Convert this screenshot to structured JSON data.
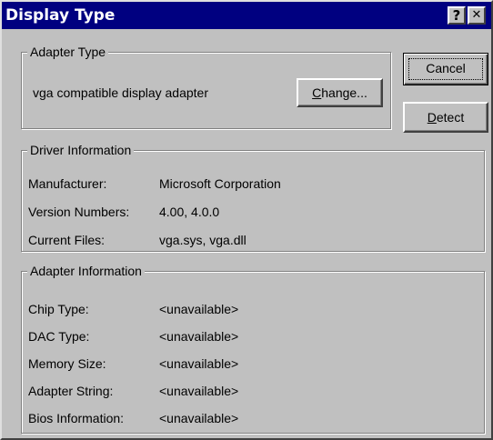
{
  "window": {
    "title": "Display Type",
    "help_glyph": "?",
    "close_glyph": "✕"
  },
  "buttons": {
    "cancel": "Cancel",
    "detect_mnemonic": "D",
    "detect_rest": "etect",
    "change_mnemonic": "C",
    "change_rest": "hange..."
  },
  "adapter_type": {
    "legend": "Adapter Type",
    "value": "vga compatible display adapter"
  },
  "driver_info": {
    "legend": "Driver Information",
    "rows": [
      {
        "label": "Manufacturer:",
        "value": "Microsoft Corporation"
      },
      {
        "label": "Version Numbers:",
        "value": "4.00, 4.0.0"
      },
      {
        "label": "Current Files:",
        "value": "vga.sys, vga.dll"
      }
    ]
  },
  "adapter_info": {
    "legend": "Adapter Information",
    "rows": [
      {
        "label": "Chip Type:",
        "value": "<unavailable>"
      },
      {
        "label": "DAC Type:",
        "value": "<unavailable>"
      },
      {
        "label": "Memory Size:",
        "value": "<unavailable>"
      },
      {
        "label": "Adapter String:",
        "value": "<unavailable>"
      },
      {
        "label": "Bios Information:",
        "value": "<unavailable>"
      }
    ]
  }
}
